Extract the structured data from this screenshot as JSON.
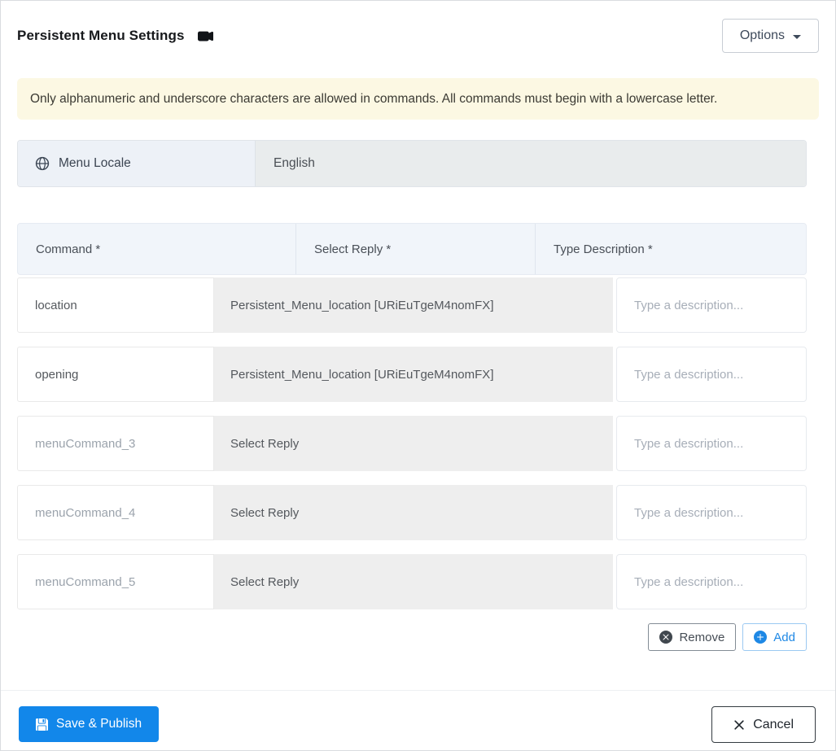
{
  "header": {
    "title": "Persistent Menu Settings",
    "options_button": "Options"
  },
  "notice": {
    "text": "Only alphanumeric and underscore characters are allowed in commands. All commands must begin with a lowercase letter."
  },
  "locale": {
    "label": "Menu Locale",
    "value": "English"
  },
  "table": {
    "headers": [
      "Command *",
      "Select Reply *",
      "Type Description *"
    ],
    "rows": [
      {
        "command_value": "location",
        "command_placeholder": "",
        "reply": "Persistent_Menu_location [URiEuTgeM4nomFX]",
        "description_value": "",
        "description_placeholder": "Type a description..."
      },
      {
        "command_value": "opening",
        "command_placeholder": "",
        "reply": "Persistent_Menu_location [URiEuTgeM4nomFX]",
        "description_value": "",
        "description_placeholder": "Type a description..."
      },
      {
        "command_value": "",
        "command_placeholder": "menuCommand_3",
        "reply": "Select Reply",
        "description_value": "",
        "description_placeholder": "Type a description..."
      },
      {
        "command_value": "",
        "command_placeholder": "menuCommand_4",
        "reply": "Select Reply",
        "description_value": "",
        "description_placeholder": "Type a description..."
      },
      {
        "command_value": "",
        "command_placeholder": "menuCommand_5",
        "reply": "Select Reply",
        "description_value": "",
        "description_placeholder": "Type a description..."
      }
    ]
  },
  "row_actions": {
    "remove_label": "Remove",
    "add_label": "Add"
  },
  "footer": {
    "save_label": "Save & Publish",
    "cancel_label": "Cancel"
  },
  "colors": {
    "primary_blue": "#1287ea",
    "add_blue": "#1e88e5",
    "warning_bg": "#fcf8e3",
    "select_gray": "#eeeeee",
    "table_header_bg": "#f1f5fa",
    "locale_label_bg": "#edf1f7",
    "locale_value_bg": "#e9eced"
  }
}
